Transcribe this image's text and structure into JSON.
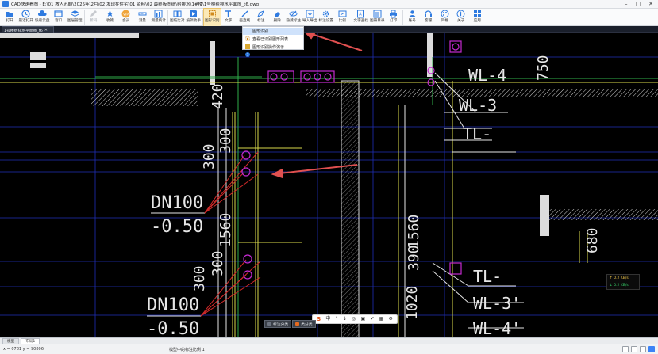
{
  "window": {
    "title": "CAD快速看图 - E:\\01 教人苏酮\\2025年\\2月\\02 发现在住宅\\01 资料\\02 最终板图纸\\给排水\\1#楼\\1号楼给排水平面图_t6.dwg",
    "minimize": "–",
    "maximize": "□",
    "close": "✕"
  },
  "ribbon": {
    "tools": [
      {
        "name": "open",
        "label": "打开",
        "icon": "folder-icon",
        "active": false,
        "disabled": false
      },
      {
        "name": "recent",
        "label": "最近打开",
        "icon": "clock-icon",
        "active": false,
        "disabled": false
      },
      {
        "name": "cloud",
        "label": "快看云盘",
        "icon": "cloud-icon",
        "active": false,
        "disabled": false
      },
      {
        "name": "window",
        "label": "窗口",
        "icon": "window-icon",
        "active": false,
        "disabled": false
      },
      {
        "name": "layers",
        "label": "图层管理",
        "icon": "layers-icon",
        "active": false,
        "disabled": false
      },
      {
        "name": "new-draw",
        "label": "新码",
        "icon": "pencil-icon",
        "active": false,
        "disabled": true
      },
      {
        "name": "fav",
        "label": "收藏",
        "icon": "star-icon",
        "active": false,
        "disabled": false
      },
      {
        "name": "vip",
        "label": "会员",
        "icon": "vip-icon",
        "active": false,
        "disabled": false
      },
      {
        "name": "measure",
        "label": "测量",
        "icon": "ruler-icon",
        "active": false,
        "disabled": false
      },
      {
        "name": "measure-stat",
        "label": "测量统计",
        "icon": "stats-icon",
        "active": false,
        "disabled": false
      },
      {
        "name": "compare",
        "label": "图纸比对",
        "icon": "compare-icon",
        "active": false,
        "disabled": false
      },
      {
        "name": "assistant",
        "label": "编辑助手",
        "icon": "play-icon",
        "active": false,
        "disabled": false
      },
      {
        "name": "shape-recog",
        "label": "图形识别",
        "icon": "shape-icon",
        "active": true,
        "disabled": false
      },
      {
        "name": "text",
        "label": "文字",
        "icon": "text-icon",
        "active": false,
        "disabled": false
      },
      {
        "name": "line",
        "label": "画直线",
        "icon": "line-icon",
        "active": false,
        "disabled": false
      },
      {
        "name": "annotate",
        "label": "标注",
        "icon": "annotate-icon",
        "active": false,
        "disabled": false
      },
      {
        "name": "delete",
        "label": "删除",
        "icon": "eraser-icon",
        "active": false,
        "disabled": false
      },
      {
        "name": "hide-mark",
        "label": "隐藏标注",
        "icon": "eye-off-icon",
        "active": false,
        "disabled": false
      },
      {
        "name": "import-export",
        "label": "导入导出",
        "icon": "import-icon",
        "active": false,
        "disabled": false
      },
      {
        "name": "mark-setting",
        "label": "标注设置",
        "icon": "gear-icon",
        "active": false,
        "disabled": false
      },
      {
        "name": "ratio",
        "label": "比例",
        "icon": "ratio-icon",
        "active": false,
        "disabled": false
      },
      {
        "name": "text-search",
        "label": "文字查找",
        "icon": "doc-search-icon",
        "active": false,
        "disabled": false
      },
      {
        "name": "drawing-dir",
        "label": "图册目录",
        "icon": "catalog-icon",
        "active": false,
        "disabled": false
      },
      {
        "name": "print",
        "label": "打印",
        "icon": "printer-icon",
        "active": false,
        "disabled": false
      },
      {
        "name": "account",
        "label": "账号",
        "icon": "user-icon",
        "active": false,
        "disabled": false
      },
      {
        "name": "service",
        "label": "客服",
        "icon": "headset-icon",
        "active": false,
        "disabled": false
      },
      {
        "name": "style",
        "label": "风格",
        "icon": "palette-icon",
        "active": false,
        "disabled": false
      },
      {
        "name": "about",
        "label": "关于",
        "icon": "info-icon",
        "active": false,
        "disabled": false
      },
      {
        "name": "apps",
        "label": "应用",
        "icon": "grid-icon",
        "active": false,
        "disabled": false
      }
    ]
  },
  "doc_tab": {
    "label": "1号楼给排水平面图_t6",
    "close": "✕"
  },
  "menu": {
    "items": [
      {
        "label": "图形识别",
        "icon": "shape-icon",
        "highlight": true
      },
      {
        "label": "查看已识别图形列表",
        "icon": "list-icon",
        "highlight": false
      },
      {
        "label": "图形识别操作演示",
        "icon": "help-icon",
        "highlight": false
      }
    ]
  },
  "drawing": {
    "labels": {
      "wl4": "WL-4",
      "wl3": "WL-3",
      "tl": "TL-",
      "n750": "750",
      "n420": "420",
      "n300a": "300",
      "n300b": "300",
      "n1560a": "1560",
      "n1560b": "1560",
      "dn100a": "DN100",
      "dn100b": "DN100",
      "m050a": "-0.50",
      "m050b": "-0.50",
      "n300c": "300",
      "n300d": "300",
      "n680": "680",
      "n1020": "1020",
      "n390": "390",
      "tl2": "TL-",
      "wl3b": "WL-3'",
      "wl4b": "WL-4'"
    }
  },
  "net": {
    "up": "↑ 0.2 KB/s",
    "down": "↓ 0.2 KB/s"
  },
  "float_toolbar": {
    "logo": "S",
    "items": [
      "中",
      "°",
      "↓",
      "◎",
      "▣",
      "✔",
      "▦",
      "⚙"
    ]
  },
  "class_buttons": [
    {
      "label": "标注分类",
      "color": "#6c7380"
    },
    {
      "label": "类分类",
      "color": "#e76a1e"
    }
  ],
  "layout_tabs": [
    {
      "label": "模型",
      "active": false
    },
    {
      "label": "布局1",
      "active": true
    }
  ],
  "status": {
    "coords": "x = 0781 y = 90806",
    "scale": "模型中的标注比例 1"
  },
  "colors": {
    "accent": "#2f7be0",
    "grid_blue": "#1f2fb8",
    "pipe_yellow": "#d8d84a",
    "pipe_red": "#d12a2a",
    "pipe_green": "#2fae4a",
    "pipe_magenta": "#c42ad0",
    "text_white": "#e6e6e6",
    "arrow_red": "#e05050"
  }
}
